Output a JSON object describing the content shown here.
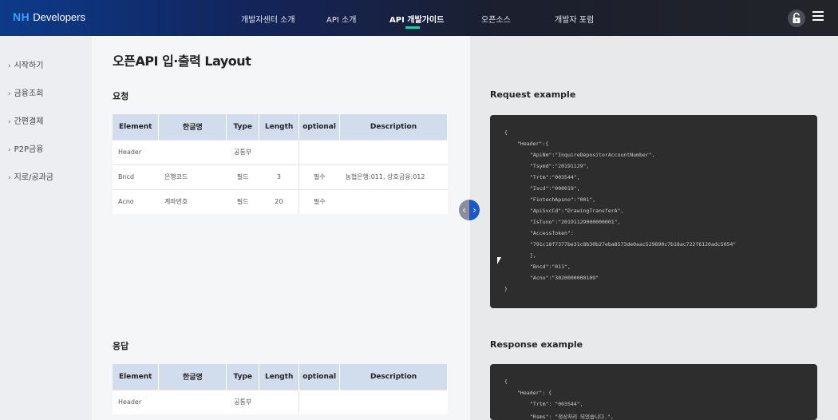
{
  "header": {
    "logo_brand": "NH",
    "logo_text": "Developers",
    "nav": [
      {
        "label": "개발자센터 소개"
      },
      {
        "label": "API 소개"
      },
      {
        "label": "API 개발가이드"
      },
      {
        "label": "오픈소스"
      },
      {
        "label": "개발자 포럼"
      }
    ],
    "active_nav": "API 개발가이드",
    "accent_color": "#1fd3a0",
    "lock_icon": "lock-icon",
    "menu_icon": "hamburger-menu-icon"
  },
  "sidebar": {
    "items": [
      {
        "label": "시작하기"
      },
      {
        "label": "금융조회"
      },
      {
        "label": "간편결제"
      },
      {
        "label": "P2P금융"
      },
      {
        "label": "지로/공과금"
      }
    ]
  },
  "main": {
    "title": "오픈API 입·출력 Layout",
    "request": {
      "title": "요청",
      "columns": [
        "Element",
        "한글명",
        "Type",
        "Length",
        "optional",
        "Description"
      ],
      "rows": [
        {
          "element": "Header",
          "korean": "",
          "type": "공통부",
          "length": "",
          "optional": "",
          "description": ""
        },
        {
          "element": "Bncd",
          "korean": "은행코드",
          "type": "필드",
          "length": "3",
          "optional": "필수",
          "description": "농협은행:011, 상호금융:012"
        },
        {
          "element": "Acno",
          "korean": "계좌번호",
          "type": "필드",
          "length": "20",
          "optional": "필수",
          "description": ""
        }
      ]
    },
    "response": {
      "title": "응답",
      "columns": [
        "Element",
        "한글명",
        "Type",
        "Length",
        "optional",
        "Description"
      ],
      "rows": [
        {
          "element": "Header",
          "korean": "",
          "type": "공통부",
          "length": "",
          "optional": "",
          "description": ""
        }
      ]
    }
  },
  "right": {
    "request_title": "Request example",
    "request_lines": [
      "{",
      "\"Header\":{",
      "\"ApiNm\":\"InquireDepositorAccountNumber\",",
      "\"Tsymd\":\"20191129\",",
      "\"Trtm\":\"003544\",",
      "\"Iscd\":\"000019\",",
      "\"FintechApsno\":\"001\",",
      "\"ApiSvcCd\":\"DrawingTransferA\",",
      "\"IsTuno\":\"20191129000000001\",",
      "\"AccessToken\":",
      "\"791c18f7377be31c8b30b27eba8573de0aac529890c7b18ac722f6120adc5054\"",
      "},",
      "\"Bncd\":\"011\",",
      "\"Acno\":\"3020000000109\"",
      "}"
    ],
    "response_title": "Response example",
    "response_lines": [
      "{",
      "\"Header\": {",
      "\"Trtm\": \"003544\",",
      "\"Rsms\": \"정상처리 되었습니다.\","
    ]
  },
  "toggle": {
    "left_icon": "chevron-left-icon",
    "right_icon": "chevron-right-icon"
  }
}
